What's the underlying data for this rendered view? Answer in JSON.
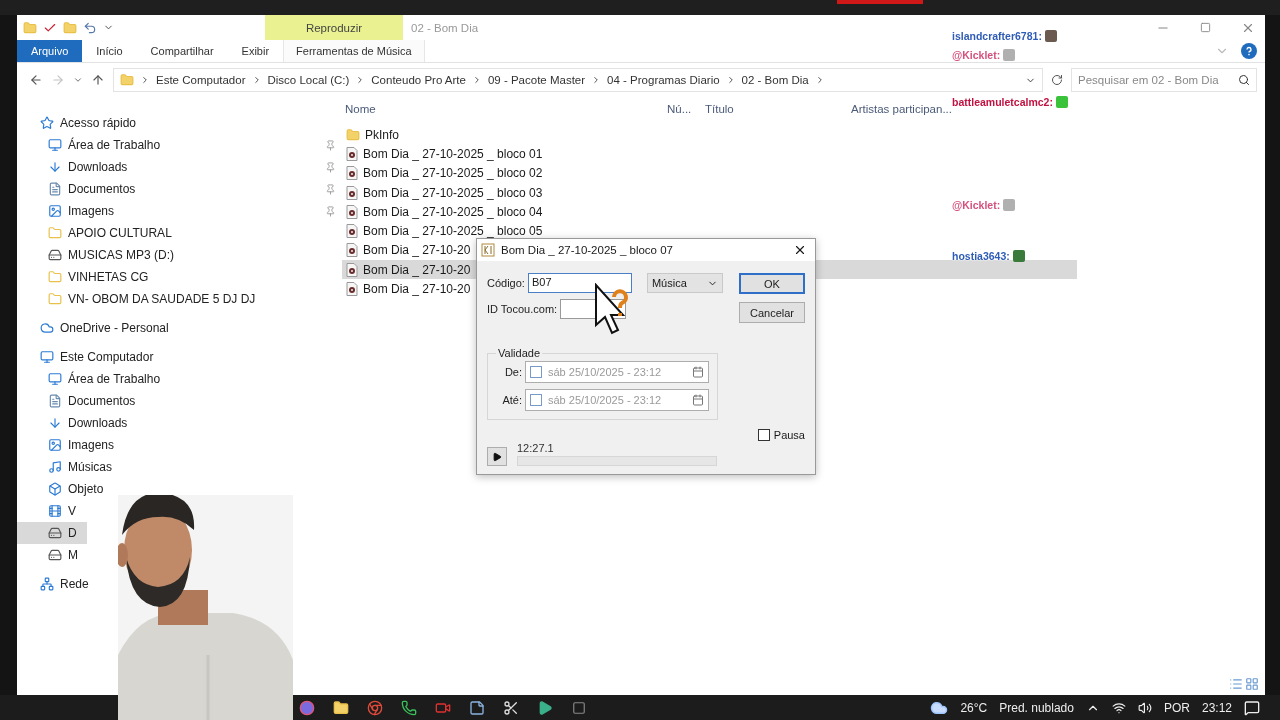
{
  "title_bar": {
    "contextual_tab": "Reproduzir",
    "title": "02 - Bom Dia"
  },
  "ribbon_tabs": [
    {
      "label": "Arquivo",
      "selected": true
    },
    {
      "label": "Início",
      "selected": false
    },
    {
      "label": "Compartilhar",
      "selected": false
    },
    {
      "label": "Exibir",
      "selected": false
    },
    {
      "label": "Ferramentas de Música",
      "selected": false
    }
  ],
  "address": {
    "crumbs": [
      "Este Computador",
      "Disco Local (C:)",
      "Conteudo Pro Arte",
      "09 - Pacote Master",
      "04 - Programas Diario",
      "02 - Bom Dia"
    ],
    "search_placeholder": "Pesquisar em 02 - Bom Dia"
  },
  "sidebar": {
    "sections": [
      {
        "label": "Acesso rápido",
        "children": [
          {
            "label": "Área de Trabalho",
            "pinned": true,
            "selected": false
          },
          {
            "label": "Downloads",
            "pinned": true,
            "selected": false
          },
          {
            "label": "Documentos",
            "pinned": true,
            "selected": false
          },
          {
            "label": "Imagens",
            "pinned": true,
            "selected": false
          },
          {
            "label": "APOIO CULTURAL",
            "pinned": false,
            "selected": false
          },
          {
            "label": "MUSICAS MP3 (D:)",
            "pinned": false,
            "selected": false
          },
          {
            "label": "VINHETAS CG",
            "pinned": false,
            "selected": false
          },
          {
            "label": "VN- OBOM DA SAUDADE 5 DJ DJ",
            "pinned": false,
            "selected": false
          }
        ]
      },
      {
        "label": "OneDrive - Personal"
      },
      {
        "label": "Este Computador",
        "children": [
          {
            "label": "Área de Trabalho",
            "pinned": false,
            "selected": false
          },
          {
            "label": "Documentos",
            "pinned": false,
            "selected": false
          },
          {
            "label": "Downloads",
            "pinned": false,
            "selected": false
          },
          {
            "label": "Imagens",
            "pinned": false,
            "selected": false
          },
          {
            "label": "Músicas",
            "pinned": false,
            "selected": false
          },
          {
            "label": "Objeto",
            "pinned": false,
            "selected": false
          },
          {
            "label": "V",
            "pinned": false,
            "selected": false
          },
          {
            "label": "D",
            "pinned": false,
            "selected": true
          },
          {
            "label": "M",
            "pinned": false,
            "selected": false
          }
        ]
      },
      {
        "label": "Rede"
      }
    ]
  },
  "columns": [
    "Nome",
    "Nú...",
    "Título",
    "Artistas participan..."
  ],
  "files": [
    {
      "name": "PkInfo",
      "kind": "folder",
      "selected": false
    },
    {
      "name": "Bom Dia _ 27-10-2025 _ bloco 01",
      "kind": "audio",
      "selected": false
    },
    {
      "name": "Bom Dia _ 27-10-2025 _ bloco 02",
      "kind": "audio",
      "selected": false
    },
    {
      "name": "Bom Dia _ 27-10-2025 _ bloco 03",
      "kind": "audio",
      "selected": false
    },
    {
      "name": "Bom Dia _ 27-10-2025 _ bloco 04",
      "kind": "audio",
      "selected": false
    },
    {
      "name": "Bom Dia _ 27-10-2025 _ bloco 05",
      "kind": "audio",
      "selected": false
    },
    {
      "name": "Bom Dia _ 27-10-20",
      "kind": "audio",
      "selected": false
    },
    {
      "name": "Bom Dia _ 27-10-20",
      "kind": "audio",
      "selected": true
    },
    {
      "name": "Bom Dia _ 27-10-20",
      "kind": "audio",
      "selected": false
    }
  ],
  "dialog": {
    "title": "Bom Dia _ 27-10-2025 _ bloco 07",
    "code_label": "Código:",
    "code_value": "B07",
    "type_value": "Música",
    "id_label": "ID Tocou.com:",
    "ok": "OK",
    "cancel": "Cancelar",
    "validity_label": "Validade",
    "dates": [
      {
        "label": "De:",
        "value": "sáb 25/10/2025 - 23:12",
        "checked": false
      },
      {
        "label": "Até:",
        "value": "sáb 25/10/2025 - 23:12",
        "checked": false
      }
    ],
    "pause": {
      "label": "Pausa",
      "checked": false
    },
    "time": "12:27.1",
    "progress": {
      "level": 0
    }
  },
  "chat": [
    {
      "user": "islandcrafter6781:",
      "color": "#2f5cb5"
    },
    {
      "user": "@Kicklet:",
      "color": "#d4507c"
    },
    {
      "user": "battleamuletcalmc2:",
      "color": "#c21040"
    },
    {
      "user": "@Kicklet:",
      "color": "#d4507c"
    },
    {
      "user": "hostia3643:",
      "color": "#2f5cb5"
    }
  ],
  "taskbar": {
    "temperature": "26°C",
    "forecast": "Pred. nublado",
    "language": "POR",
    "time": "23:12"
  }
}
